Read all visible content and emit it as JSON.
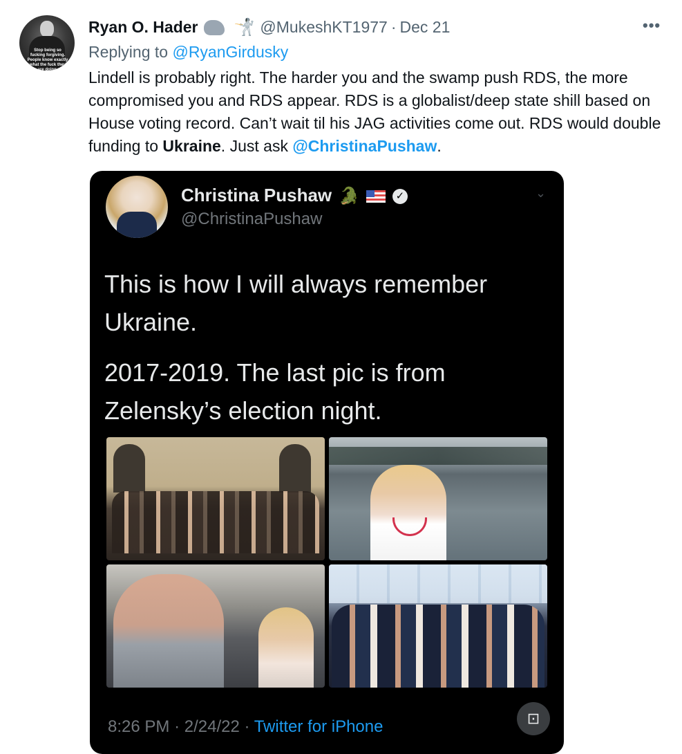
{
  "tweet": {
    "avatar_caption": "Stop being so fucking forgiving. People know exactly what the fuck they are doing.",
    "display_name": "Ryan O. Hader",
    "name_emojis": [
      "rhino-emoji",
      "fencer-emoji"
    ],
    "fencer_glyph": "🤺",
    "handle": "@MukeshKT1977",
    "separator": "·",
    "date": "Dec 21",
    "more_label": "•••",
    "replying_prefix": "Replying to",
    "replying_to": "@RyanGirdusky",
    "text_part1": "Lindell is probably right. The harder you and the swamp push RDS, the more compromised you and RDS appear. RDS is a globalist/deep state shill based on House voting record. Can’t wait til his JAG activities come out. RDS would double funding to ",
    "text_bold": "Ukraine",
    "text_part2": ". Just ask ",
    "text_mention": "@ChristinaPushaw",
    "text_end": "."
  },
  "embedded_screenshot": {
    "name": "Christina Pushaw",
    "gator_glyph": "🐊",
    "verified_glyph": "✓",
    "chevron_glyph": "⌄",
    "handle": "@ChristinaPushaw",
    "text_line1": "This is how I will always remember",
    "text_line2": "Ukraine.",
    "text_line3": "2017-2019. The last pic is from",
    "text_line4": "Zelensky’s election night.",
    "time": "8:26 PM",
    "separator": "·",
    "date": "2/24/22",
    "client": "Twitter for iPhone",
    "scan_glyph": "⊡"
  },
  "colors": {
    "link": "#1d9bf0",
    "text_primary": "#0f1419",
    "text_secondary": "#536471",
    "screenshot_bg": "#000000"
  }
}
